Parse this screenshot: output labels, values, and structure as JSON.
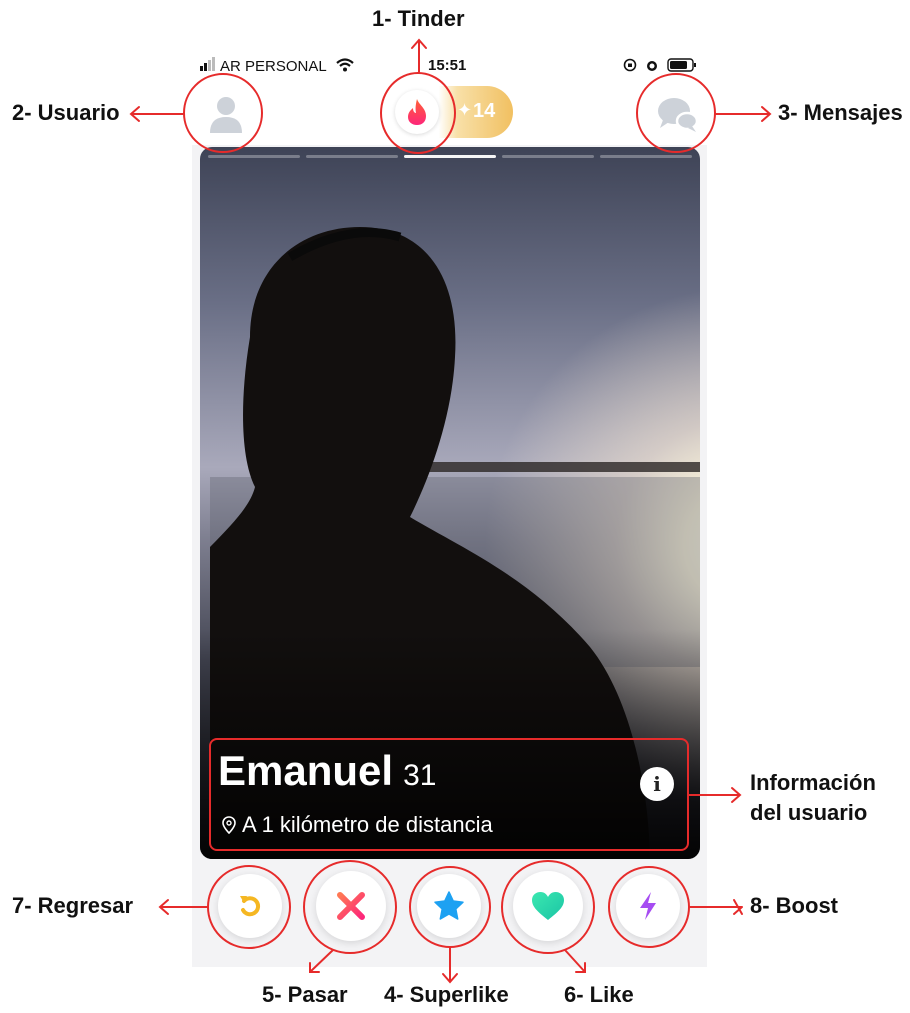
{
  "status_bar": {
    "carrier": "AR PERSONAL",
    "time": "15:51"
  },
  "header": {
    "boost_count": "14"
  },
  "profile": {
    "name": "Emanuel",
    "age": "31",
    "distance": "A 1 kilómetro de distancia",
    "info_glyph": "i"
  },
  "actions": [
    {
      "name": "rewind",
      "icon": "rewind-icon",
      "color": "#f5b722"
    },
    {
      "name": "nope",
      "icon": "close-icon",
      "color": "#fd5068"
    },
    {
      "name": "superlike",
      "icon": "star-icon",
      "color": "#1da1f2"
    },
    {
      "name": "like",
      "icon": "heart-icon",
      "color": "#1ed9a3"
    },
    {
      "name": "boost",
      "icon": "lightning-icon",
      "color": "#a64cf2"
    }
  ],
  "annotations": {
    "tinder": "1- Tinder",
    "usuario": "2- Usuario",
    "mensajes": "3- Mensajes",
    "superlike": "4- Superlike",
    "pasar": "5- Pasar",
    "like": "6- Like",
    "regresar": "7- Regresar",
    "boost": "8- Boost",
    "informacion_line1": "Información",
    "informacion_line2": "del usuario"
  },
  "colors": {
    "annotation_red": "#e62b2b",
    "tinder_gradient_start": "#fd267a",
    "tinder_gradient_end": "#ff6036",
    "gold": "#f1c061"
  }
}
